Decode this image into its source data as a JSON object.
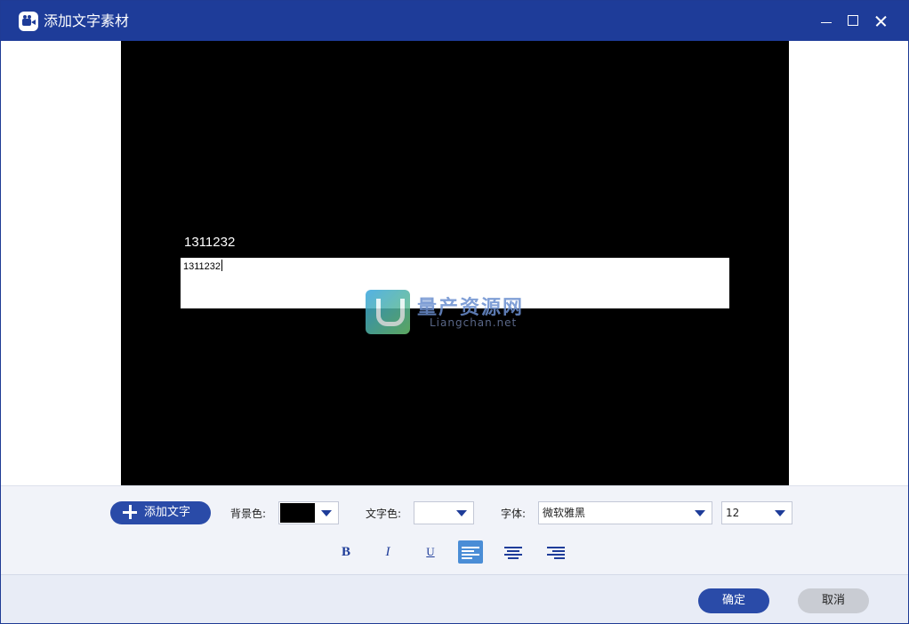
{
  "window": {
    "title": "添加文字素材",
    "app_icon": "video-camera-icon",
    "controls": {
      "minimize_icon": "minimize-icon",
      "maximize_icon": "maximize-icon",
      "close_icon": "close-icon"
    }
  },
  "preview": {
    "background_color": "#000000",
    "overlay_text": "1311232",
    "edit_value": "1311232",
    "watermark": {
      "cn": "量产资源网",
      "en": "Liangchan.net"
    }
  },
  "toolbar": {
    "add_text_label": "添加文字",
    "bg_color_label": "背景色:",
    "bg_color_value": "#000000",
    "text_color_label": "文字色:",
    "text_color_value": "#ffffff",
    "font_label": "字体:",
    "font_value": "微软雅黑",
    "font_size_value": "12",
    "format": {
      "bold": "B",
      "italic": "I",
      "underline": "U"
    },
    "alignment_selected": "left"
  },
  "footer": {
    "ok_label": "确定",
    "cancel_label": "取消"
  },
  "colors": {
    "accent": "#1e3c99",
    "button": "#2a4ba8",
    "active_align": "#4a8dd6"
  }
}
